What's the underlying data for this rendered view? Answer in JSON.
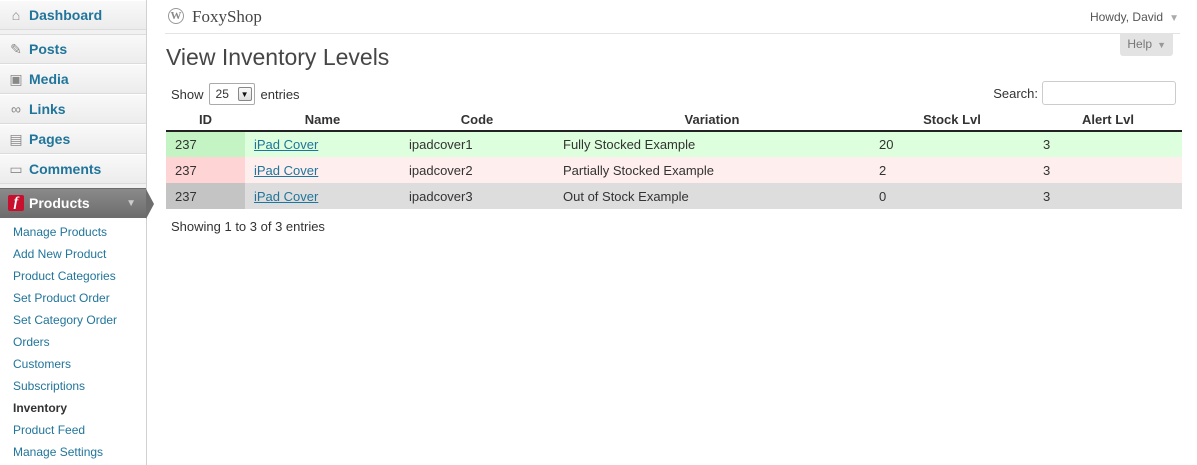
{
  "sidebar": {
    "menu": [
      {
        "label": "Dashboard",
        "icon": "dashboard-icon"
      },
      {
        "label": "Posts",
        "icon": "pushpin-icon"
      },
      {
        "label": "Media",
        "icon": "media-icon"
      },
      {
        "label": "Links",
        "icon": "link-icon"
      },
      {
        "label": "Pages",
        "icon": "pages-icon"
      },
      {
        "label": "Comments",
        "icon": "comment-icon"
      }
    ],
    "products": {
      "label": "Products",
      "icon": "foxyshop-logo-icon"
    },
    "submenu": [
      {
        "label": "Manage Products",
        "current": false
      },
      {
        "label": "Add New Product",
        "current": false
      },
      {
        "label": "Product Categories",
        "current": false
      },
      {
        "label": "Set Product Order",
        "current": false
      },
      {
        "label": "Set Category Order",
        "current": false
      },
      {
        "label": "Orders",
        "current": false
      },
      {
        "label": "Customers",
        "current": false
      },
      {
        "label": "Subscriptions",
        "current": false
      },
      {
        "label": "Inventory",
        "current": true
      },
      {
        "label": "Product Feed",
        "current": false
      },
      {
        "label": "Manage Settings",
        "current": false
      }
    ]
  },
  "header": {
    "site_title": "FoxyShop",
    "greeting": "Howdy, David",
    "help_label": "Help"
  },
  "main": {
    "page_title": "View Inventory Levels",
    "length": {
      "prefix": "Show",
      "value": "25",
      "suffix": "entries"
    },
    "search": {
      "label": "Search:",
      "value": "",
      "placeholder": ""
    },
    "table": {
      "columns": [
        "ID",
        "Name",
        "Code",
        "Variation",
        "Stock Lvl",
        "Alert Lvl"
      ],
      "rows": [
        {
          "id": "237",
          "name": "iPad Cover",
          "code": "ipadcover1",
          "variation": "Fully Stocked Example",
          "stock": "20",
          "alert": "3",
          "status": "in-stock"
        },
        {
          "id": "237",
          "name": "iPad Cover",
          "code": "ipadcover2",
          "variation": "Partially Stocked Example",
          "stock": "2",
          "alert": "3",
          "status": "low-stock"
        },
        {
          "id": "237",
          "name": "iPad Cover",
          "code": "ipadcover3",
          "variation": "Out of Stock Example",
          "stock": "0",
          "alert": "3",
          "status": "out-of-stock"
        }
      ]
    },
    "info": "Showing 1 to 3 of 3 entries"
  },
  "colors": {
    "link": "#21759b",
    "in_stock_row": "#ddffdd",
    "low_stock_row": "#ffeeee",
    "out_of_stock_row": "#dddddd",
    "menu_active": "#6d6d6d"
  }
}
